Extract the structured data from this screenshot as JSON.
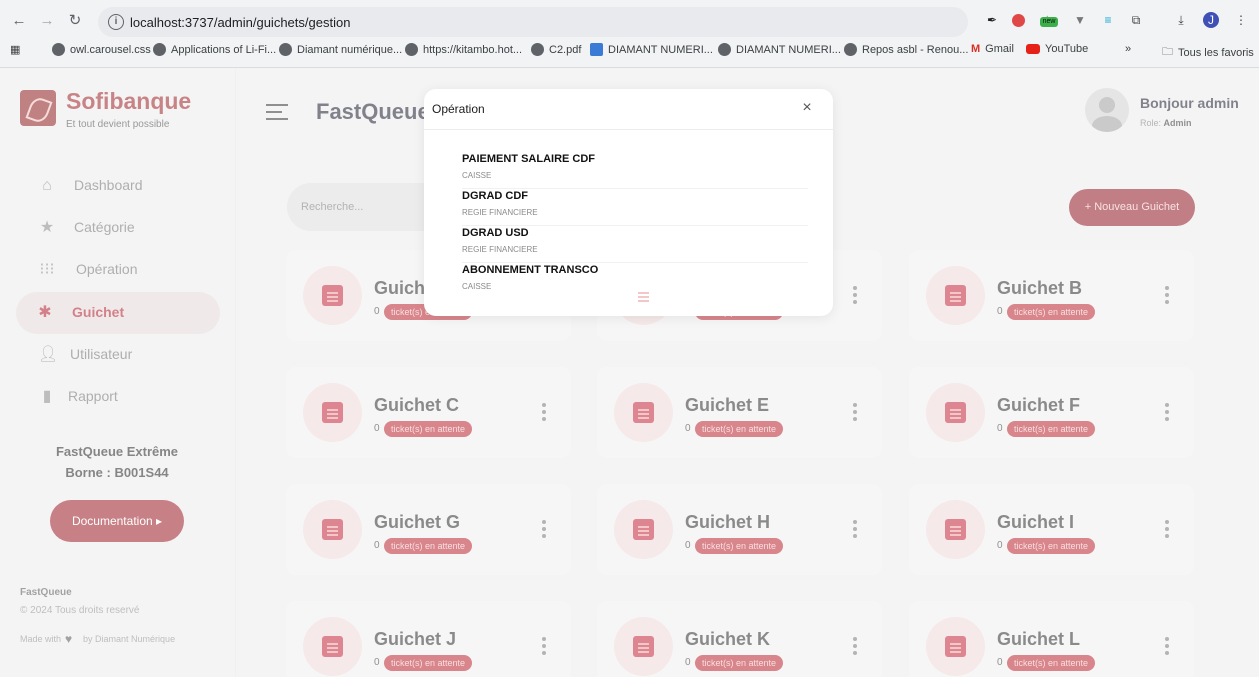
{
  "browser": {
    "url": "localhost:3737/admin/guichets/gestion",
    "bookmarks": [
      "owl.carousel.css",
      "Applications of Li-Fi...",
      "Diamant numérique...",
      "https://kitambo.hot...",
      "C2.pdf",
      "DIAMANT NUMERI...",
      "DIAMANT NUMERI...",
      "Repos asbl - Renou...",
      "Gmail",
      "YouTube"
    ],
    "bookmarks_more": "»",
    "all_bookmarks": "Tous les favoris",
    "ext_new_badge": "new"
  },
  "sidebar": {
    "brand": "Sofibanque",
    "tagline": "Et tout devient possible",
    "items": [
      {
        "label": "Dashboard",
        "icon": "home-icon"
      },
      {
        "label": "Catégorie",
        "icon": "star-icon"
      },
      {
        "label": "Opération",
        "icon": "grid-icon"
      },
      {
        "label": "Guichet",
        "icon": "gear-icon",
        "active": true
      },
      {
        "label": "Utilisateur",
        "icon": "user-icon"
      },
      {
        "label": "Rapport",
        "icon": "file-icon"
      }
    ],
    "card_title": "FastQueue Extrême",
    "card_borne": "Borne : B001S44",
    "doc_button": "Documentation ▸",
    "footer_brand": "FastQueue",
    "footer_copy": "© 2024 Tous droits reservé",
    "footer_made_with": "Made with",
    "footer_by": "by Diamant Numérique"
  },
  "header": {
    "title": "FastQueue",
    "greeting": "Bonjour admin",
    "role_label": "Role:",
    "role_value": "Admin"
  },
  "toolbar": {
    "search_placeholder": "Recherche...",
    "new_button": "+ Nouveau Guichet"
  },
  "guichets": [
    {
      "name": "Guichet A",
      "count": "0",
      "badge": "ticket(s) en attente"
    },
    {
      "name": "Guichet",
      "count": "0",
      "badge": "ticket(s) en attente"
    },
    {
      "name": "Guichet B",
      "count": "0",
      "badge": "ticket(s) en attente"
    },
    {
      "name": "Guichet C",
      "count": "0",
      "badge": "ticket(s) en attente"
    },
    {
      "name": "Guichet E",
      "count": "0",
      "badge": "ticket(s) en attente"
    },
    {
      "name": "Guichet F",
      "count": "0",
      "badge": "ticket(s) en attente"
    },
    {
      "name": "Guichet G",
      "count": "0",
      "badge": "ticket(s) en attente"
    },
    {
      "name": "Guichet H",
      "count": "0",
      "badge": "ticket(s) en attente"
    },
    {
      "name": "Guichet I",
      "count": "0",
      "badge": "ticket(s) en attente"
    },
    {
      "name": "Guichet J",
      "count": "0",
      "badge": "ticket(s) en attente"
    },
    {
      "name": "Guichet K",
      "count": "0",
      "badge": "ticket(s) en attente"
    },
    {
      "name": "Guichet L",
      "count": "0",
      "badge": "ticket(s) en attente"
    }
  ],
  "modal": {
    "title": "Opération",
    "close": "×",
    "operations": [
      {
        "name": "PAIEMENT SALAIRE CDF",
        "category": "CAISSE"
      },
      {
        "name": "DGRAD CDF",
        "category": "REGIE FINANCIERE"
      },
      {
        "name": "DGRAD USD",
        "category": "REGIE FINANCIERE"
      },
      {
        "name": "ABONNEMENT TRANSCO",
        "category": "CAISSE"
      }
    ]
  },
  "colors": {
    "brand": "#9a1e22",
    "accent": "#b0182a",
    "badge": "#b8232f"
  }
}
